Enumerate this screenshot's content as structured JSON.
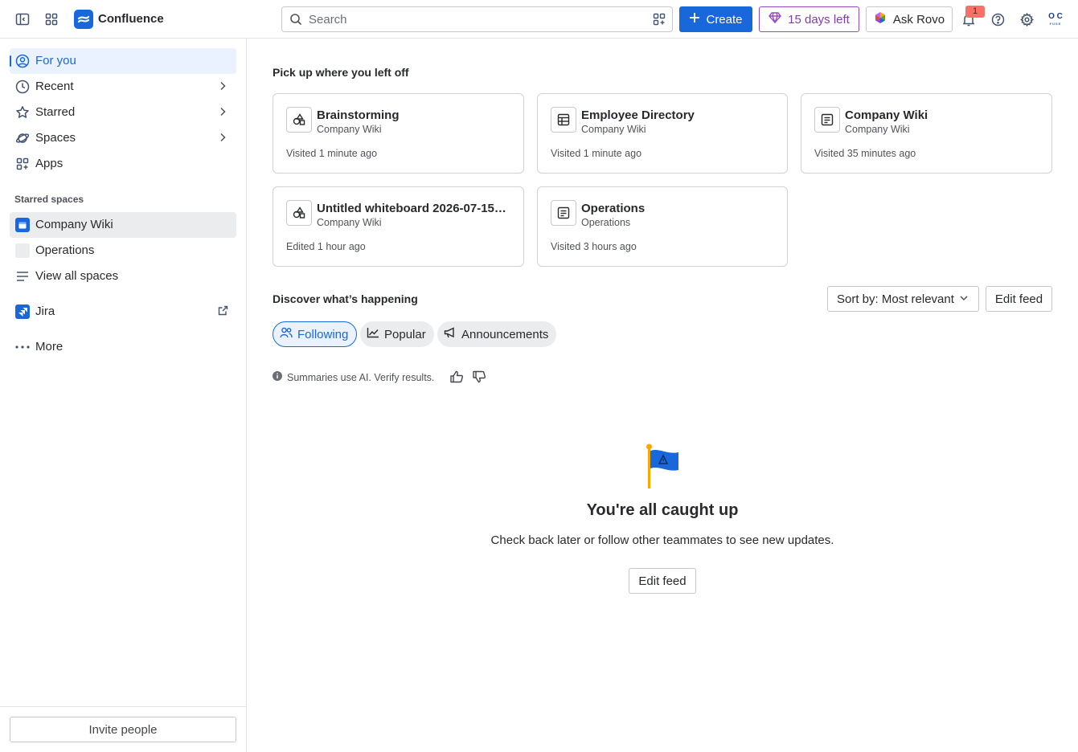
{
  "topbar": {
    "brand": "Confluence",
    "search_placeholder": "Search",
    "create_label": "Create",
    "trial_label": "15 days left",
    "rovo_label": "Ask Rovo",
    "notification_count": "1",
    "avatar_initials": "O C",
    "avatar_sub": "FUSE"
  },
  "sidebar": {
    "items": [
      {
        "label": "For you"
      },
      {
        "label": "Recent"
      },
      {
        "label": "Starred"
      },
      {
        "label": "Spaces"
      },
      {
        "label": "Apps"
      }
    ],
    "starred_spaces_title": "Starred spaces",
    "spaces": [
      {
        "label": "Company Wiki"
      },
      {
        "label": "Operations"
      },
      {
        "label": "View all spaces"
      }
    ],
    "jira_label": "Jira",
    "more_label": "More",
    "invite_label": "Invite people"
  },
  "main": {
    "recent_title": "Pick up where you left off",
    "cards": [
      {
        "title": "Brainstorming",
        "subtitle": "Company Wiki",
        "meta": "Visited 1 minute ago",
        "icon": "whiteboard-icon"
      },
      {
        "title": "Employee Directory",
        "subtitle": "Company Wiki",
        "meta": "Visited 1 minute ago",
        "icon": "database-icon"
      },
      {
        "title": "Company Wiki",
        "subtitle": "Company Wiki",
        "meta": "Visited 35 minutes ago",
        "icon": "page-icon"
      },
      {
        "title": "Untitled whiteboard 2026-07-15 …",
        "subtitle": "Company Wiki",
        "meta": "Edited 1 hour ago",
        "icon": "whiteboard-icon"
      },
      {
        "title": "Operations",
        "subtitle": "Operations",
        "meta": "Visited 3 hours ago",
        "icon": "page-icon"
      }
    ],
    "discover_title": "Discover what’s happening",
    "sort_label": "Sort by: Most relevant",
    "edit_feed_label": "Edit feed",
    "tabs": [
      {
        "label": "Following",
        "selected": true
      },
      {
        "label": "Popular",
        "selected": false
      },
      {
        "label": "Announcements",
        "selected": false
      }
    ],
    "ai_note": "Summaries use AI. Verify results.",
    "empty_title": "You're all caught up",
    "empty_subtitle": "Check back later or follow other teammates to see new updates.",
    "empty_button": "Edit feed"
  },
  "colors": {
    "accent": "#1868db",
    "trial": "#803fa5",
    "notification": "#f87168"
  }
}
